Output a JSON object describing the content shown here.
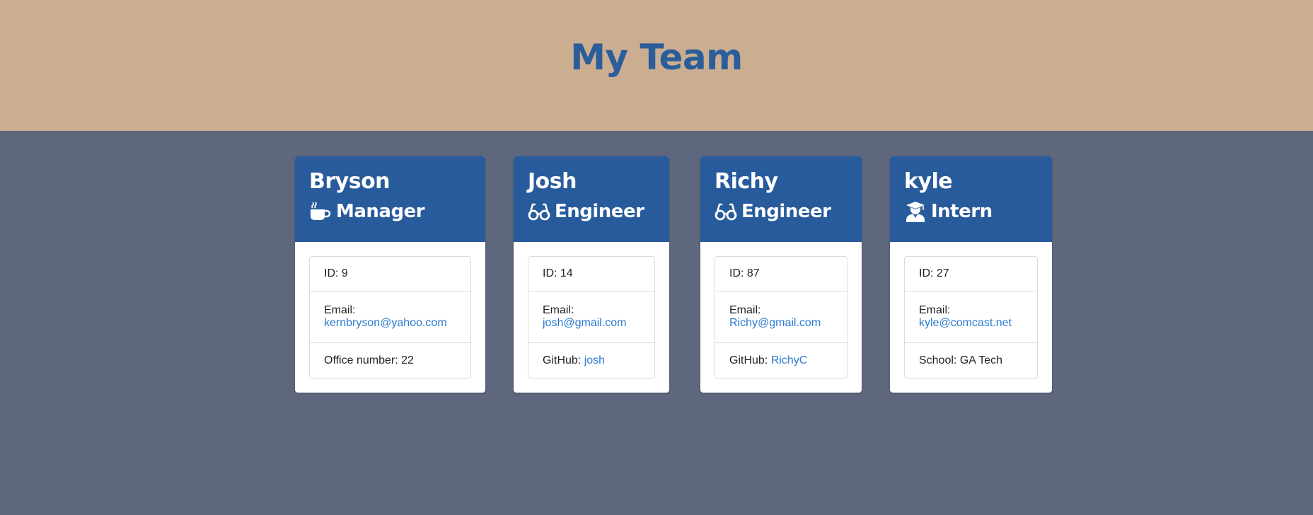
{
  "header": {
    "title": "My Team"
  },
  "colors": {
    "header_bg": "#cbad91",
    "page_bg": "#5e677d",
    "card_head_bg": "#285b9b",
    "title_color": "#2a5d9a",
    "link_color": "#2a7ad1"
  },
  "team": [
    {
      "name": "Bryson",
      "role": "Manager",
      "role_icon": "mug-icon",
      "id_label": "ID: 9",
      "email_label": "Email:",
      "email": "kernbryson@yahoo.com",
      "extra_label": "Office number: 22",
      "extra_link": ""
    },
    {
      "name": "Josh",
      "role": "Engineer",
      "role_icon": "glasses-icon",
      "id_label": "ID: 14",
      "email_label": "Email:",
      "email": "josh@gmail.com",
      "extra_label": "GitHub:",
      "extra_link": "josh"
    },
    {
      "name": "Richy",
      "role": "Engineer",
      "role_icon": "glasses-icon",
      "id_label": "ID: 87",
      "email_label": "Email:",
      "email": "Richy@gmail.com",
      "extra_label": "GitHub:",
      "extra_link": "RichyC"
    },
    {
      "name": "kyle",
      "role": "Intern",
      "role_icon": "graduate-icon",
      "id_label": "ID: 27",
      "email_label": "Email:",
      "email": "kyle@comcast.net",
      "extra_label": "School: GA Tech",
      "extra_link": ""
    }
  ]
}
